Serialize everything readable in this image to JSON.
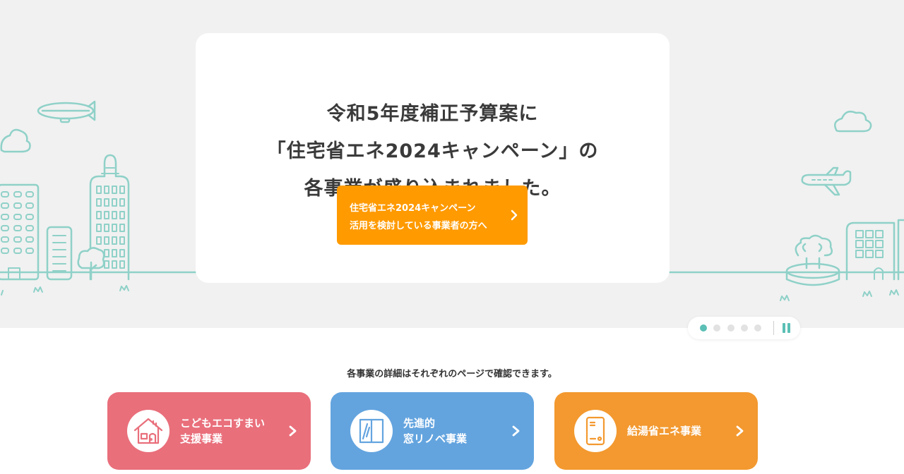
{
  "hero": {
    "headline": [
      "令和5年度補正予算案に",
      "「住宅省エネ2024キャンペーン」の",
      "各事業が盛り込まれました。"
    ],
    "cta_lines": [
      "住宅省エネ2024キャンペーン",
      "活用を検討している事業者の方へ"
    ],
    "colors": {
      "background": "#f1f1f1",
      "illustration": "#8fd1c8",
      "cta": "#ff9a00"
    }
  },
  "slider": {
    "total": 5,
    "active_index": 0,
    "pause_icon": "pause-icon",
    "accent": "#5bbfb5"
  },
  "intro_text": "各事業の詳細はそれぞれのページで確認できます。",
  "programs": [
    {
      "lines": [
        "こどもエコすまい",
        "支援事業"
      ],
      "icon": "house-icon",
      "color": "#e96f7b"
    },
    {
      "lines": [
        "先進的",
        "窓リノベ事業"
      ],
      "icon": "window-icon",
      "color": "#63a4df"
    },
    {
      "lines": [
        "給湯省エネ事業"
      ],
      "icon": "water-heater-icon",
      "color": "#f3992f"
    }
  ]
}
